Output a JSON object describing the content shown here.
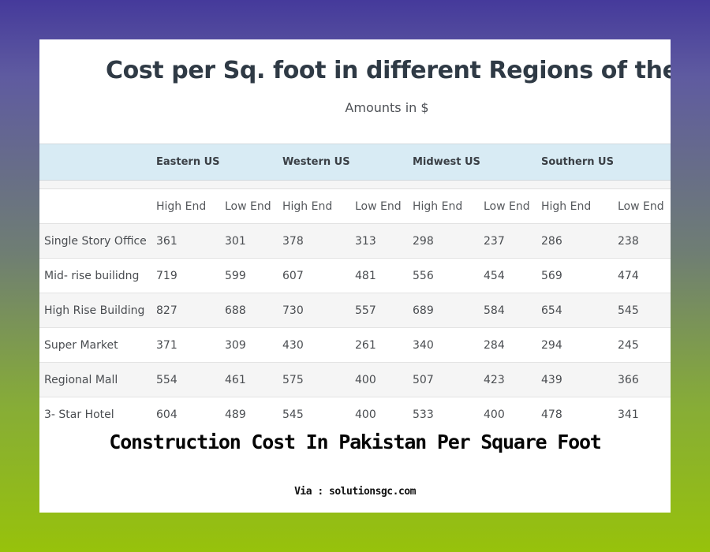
{
  "table": {
    "title": "Cost per Sq. foot in different Regions of the USA",
    "subtitle": "Amounts in $",
    "regions": [
      "Eastern US",
      "Western US",
      "Midwest US",
      "Southern US"
    ],
    "subheaders": [
      "High End",
      "Low End",
      "High End",
      "Low End",
      "High End",
      "Low End",
      "High End",
      "Low End"
    ],
    "rows": [
      {
        "label": "Single Story Office",
        "values": [
          "361",
          "301",
          "378",
          "313",
          "298",
          "237",
          "286",
          "238"
        ]
      },
      {
        "label": "Mid- rise builidng",
        "values": [
          "719",
          "599",
          "607",
          "481",
          "556",
          "454",
          "569",
          "474"
        ]
      },
      {
        "label": "High Rise Building",
        "values": [
          "827",
          "688",
          "730",
          "557",
          "689",
          "584",
          "654",
          "545"
        ]
      },
      {
        "label": "Super Market",
        "values": [
          "371",
          "309",
          "430",
          "261",
          "340",
          "284",
          "294",
          "245"
        ]
      },
      {
        "label": "Regional Mall",
        "values": [
          "554",
          "461",
          "575",
          "400",
          "507",
          "423",
          "439",
          "366"
        ]
      },
      {
        "label": "3- Star Hotel",
        "values": [
          "604",
          "489",
          "545",
          "400",
          "533",
          "400",
          "478",
          "341"
        ]
      }
    ]
  },
  "caption": {
    "title": "Construction Cost In Pakistan Per Square Foot",
    "source": "Via : solutionsgc.com"
  }
}
